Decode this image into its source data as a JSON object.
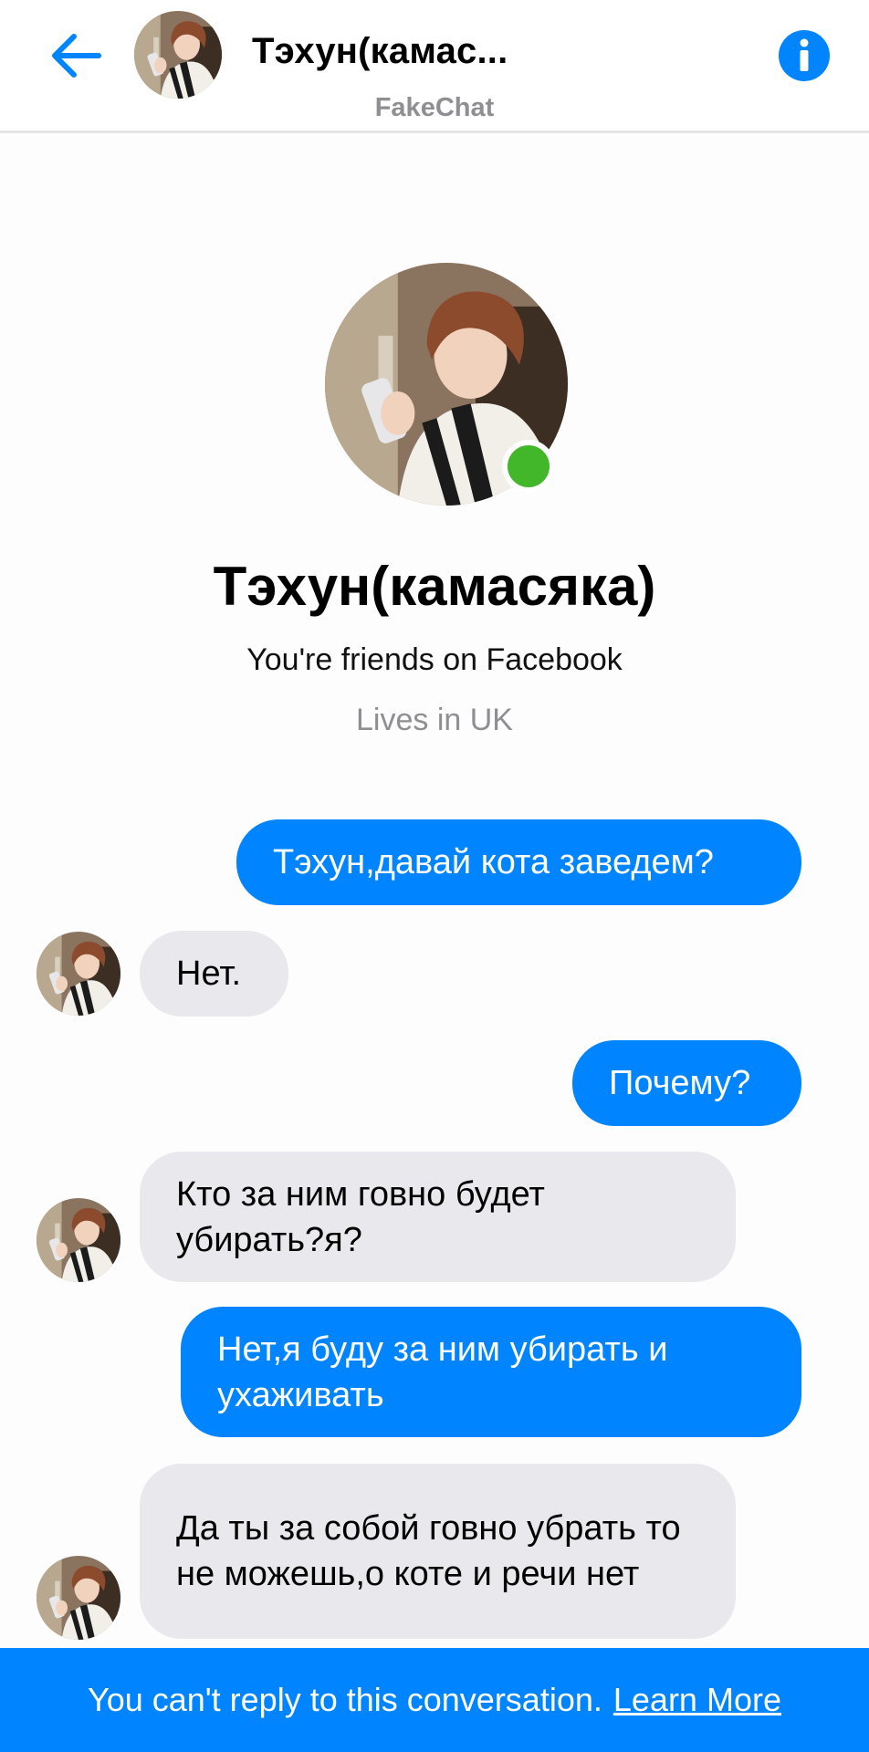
{
  "header": {
    "title": "Тэхун(камас...",
    "subtitle": "FakeChat",
    "back_icon": "arrow-left-icon",
    "info_icon": "info-icon"
  },
  "profile": {
    "name": "Тэхун(камасяка)",
    "friends_text": "You're friends on Facebook",
    "location_text": "Lives in UK",
    "online": true
  },
  "messages": [
    {
      "direction": "out",
      "text": "Тэхун,давай кота заведем?"
    },
    {
      "direction": "in",
      "text": "Нет."
    },
    {
      "direction": "out",
      "text": "Почему?"
    },
    {
      "direction": "in",
      "text": "Кто за ним говно будет убирать?я?"
    },
    {
      "direction": "out",
      "text": "Нет,я буду за ним убирать и ухаживать"
    },
    {
      "direction": "in",
      "text": "Да ты за собой говно убрать то не можешь,о коте и речи нет"
    }
  ],
  "footer": {
    "text": "You can't reply to this conversation.",
    "link": "Learn More"
  },
  "colors": {
    "accent": "#0084ff",
    "incoming_bubble": "#e9e8ec",
    "online": "#42b72a",
    "muted_text": "#8e8e93"
  }
}
